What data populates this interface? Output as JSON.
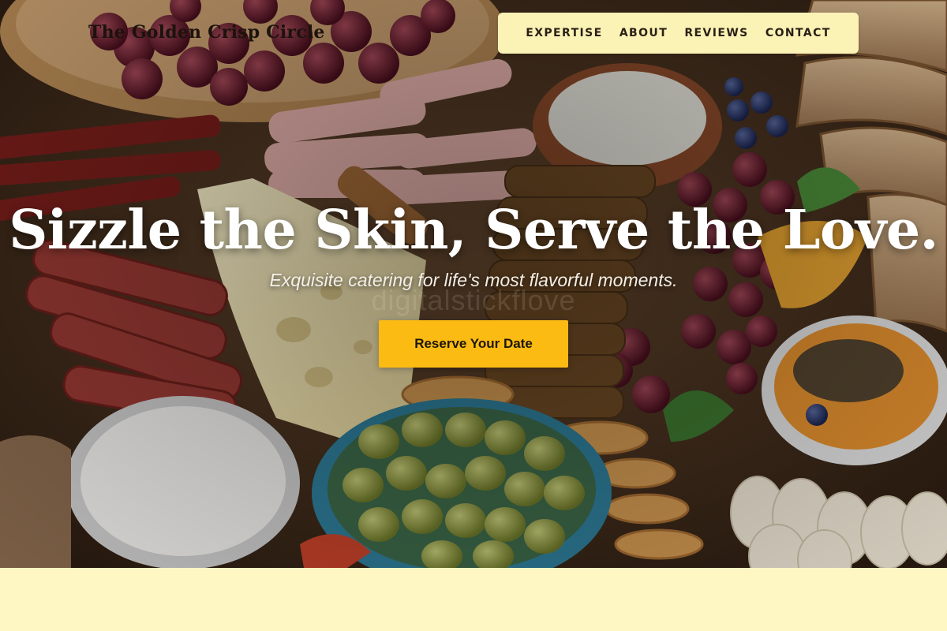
{
  "site": {
    "brand_name": "The Golden Crisp Circle",
    "hero_image": "charcuterie-board-photo"
  },
  "nav": {
    "items": [
      {
        "label": "EXPERTISE"
      },
      {
        "label": "ABOUT"
      },
      {
        "label": "REVIEWS"
      },
      {
        "label": "CONTACT"
      }
    ]
  },
  "hero": {
    "headline": "Sizzle the Skin, Serve the Love.",
    "tagline": "Exquisite catering for life's most flavorful moments.",
    "watermark_text": "digitalstickflove",
    "cta_label": "Reserve Your Date"
  },
  "colors": {
    "accent": "#fbbb12",
    "nav_background": "#fbf2b6",
    "page_background": "#fef7c3",
    "headline_text": "#ffffff"
  }
}
